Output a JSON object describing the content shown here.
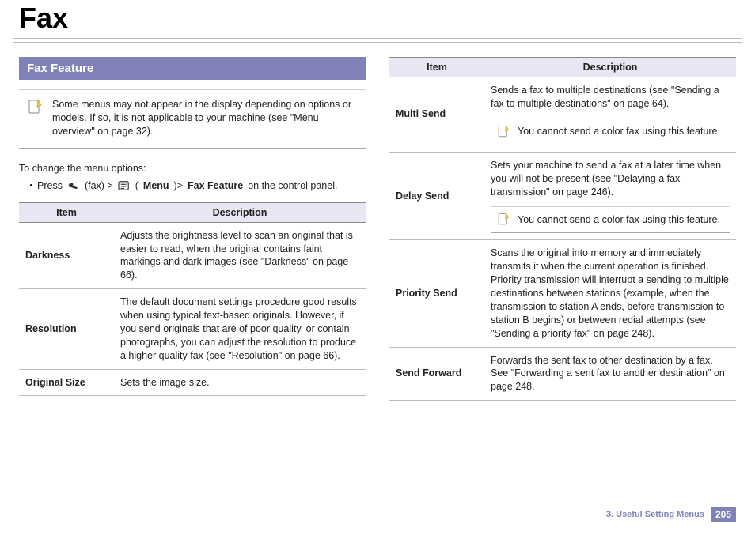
{
  "page": {
    "title": "Fax",
    "chapter": "3.  Useful Setting Menus",
    "page_number": "205"
  },
  "left": {
    "section_title": "Fax Feature",
    "note": "Some menus may not appear in the display depending on options or models. If so, it is not applicable to your machine (see \"Menu overview\" on page 32).",
    "intro": "To change the menu options:",
    "bullet": {
      "press": "Press",
      "fax": " (fax) > ",
      "menu_open": "(",
      "menu_label": "Menu",
      "menu_close": ")> ",
      "feature": "Fax Feature",
      "tail": " on the control panel."
    },
    "table": {
      "head_item": "Item",
      "head_desc": "Description",
      "rows": [
        {
          "item": "Darkness",
          "desc": "Adjusts the brightness level to scan an original that is easier to read, when the original contains faint markings and dark images (see \"Darkness\" on page 66)."
        },
        {
          "item": "Resolution",
          "desc": "The default document settings procedure good results when using typical text-based originals. However, if you send originals that are of poor quality, or contain photographs, you can adjust the resolution to produce a higher quality fax (see \"Resolution\" on page 66)."
        },
        {
          "item": "Original Size",
          "desc": "Sets the image size."
        }
      ]
    }
  },
  "right": {
    "table": {
      "head_item": "Item",
      "head_desc": "Description",
      "rows": [
        {
          "item": "Multi Send",
          "desc": "Sends a fax to multiple destinations (see \"Sending a fax to multiple destinations\" on page 64).",
          "note": "You cannot send a color fax using this feature."
        },
        {
          "item": "Delay Send",
          "desc": "Sets your machine to send a fax at a later time when you will not be present (see \"Delaying a fax transmission\" on page 246).",
          "note": "You cannot send a color fax using this feature."
        },
        {
          "item": "Priority Send",
          "desc": "Scans the original into memory and immediately transmits it when the current operation is finished. Priority transmission will interrupt a sending to multiple destinations between stations (example, when the transmission to station A ends, before transmission to station B begins) or between redial attempts (see \"Sending a priority fax\" on page 248)."
        },
        {
          "item": "Send Forward",
          "desc": "Forwards the sent fax to other destination by a fax. See \"Forwarding a sent fax to another destination\" on page 248."
        }
      ]
    }
  }
}
